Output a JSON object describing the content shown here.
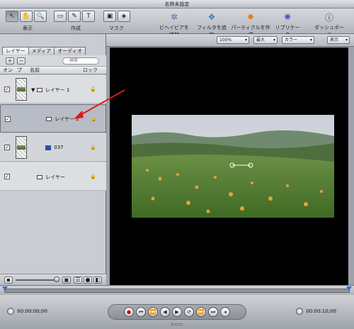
{
  "window": {
    "title": "名称未設定"
  },
  "toolbar": {
    "groups": [
      {
        "label": "表示"
      },
      {
        "label": "作成"
      },
      {
        "label": "マスク"
      }
    ],
    "right_tools": [
      {
        "label": "ビヘイビアを追加",
        "icon": "gear-icon"
      },
      {
        "label": "フィルタを追加",
        "icon": "filter-icon"
      },
      {
        "label": "パーティクルを作成",
        "icon": "particle-icon"
      },
      {
        "label": "リプリケータ",
        "icon": "replicator-icon"
      },
      {
        "label": "ダッシュボード",
        "icon": "dashboard-icon"
      }
    ]
  },
  "canvas_controls": {
    "zoom": "100%",
    "resolution": "最大",
    "color": "カラー",
    "view": "表示"
  },
  "layers_panel": {
    "tabs": [
      "レイヤー",
      "メディア",
      "オーディオ"
    ],
    "add_label": "+",
    "remove_label": "−",
    "search_placeholder": "検索",
    "columns": {
      "on": "オン",
      "preview": "プ",
      "name": "名前",
      "lock": "ロック"
    },
    "rows": [
      {
        "name": "レイヤー 1",
        "checked": "✓",
        "type": "group"
      },
      {
        "name": "レイヤー 2",
        "checked": "✓",
        "type": "layer"
      },
      {
        "name": "037",
        "checked": "✓",
        "type": "image"
      },
      {
        "name": "レイヤー",
        "checked": "✓",
        "type": "layer"
      }
    ]
  },
  "transport": {
    "current_time": "00:00:00;00",
    "end_time": "00:00:10;00"
  }
}
